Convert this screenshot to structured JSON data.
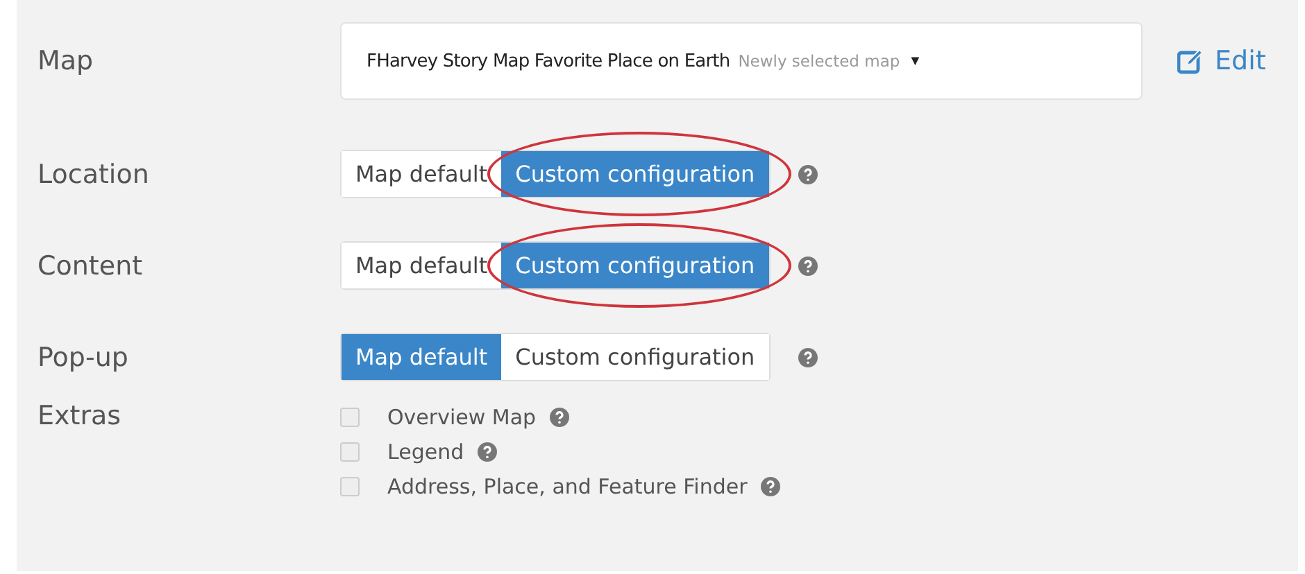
{
  "map": {
    "label": "Map",
    "title": "FHarvey Story Map Favorite Place on Earth",
    "note": "Newly selected map",
    "caret": "▼",
    "edit": "Edit"
  },
  "settings": [
    {
      "label": "Location",
      "options": [
        {
          "label": "Map default",
          "selected": false,
          "circled": false
        },
        {
          "label": "Custom configuration",
          "selected": true,
          "circled": true
        }
      ]
    },
    {
      "label": "Content",
      "options": [
        {
          "label": "Map default",
          "selected": false,
          "circled": false
        },
        {
          "label": "Custom configuration",
          "selected": true,
          "circled": true
        }
      ]
    },
    {
      "label": "Pop-up",
      "options": [
        {
          "label": "Map default",
          "selected": true,
          "circled": false
        },
        {
          "label": "Custom configuration",
          "selected": false,
          "circled": false
        }
      ]
    }
  ],
  "extras": {
    "label": "Extras",
    "items": [
      {
        "label": "Overview Map",
        "checked": false
      },
      {
        "label": "Legend",
        "checked": false
      },
      {
        "label": "Address, Place, and Feature Finder",
        "checked": false
      }
    ]
  }
}
